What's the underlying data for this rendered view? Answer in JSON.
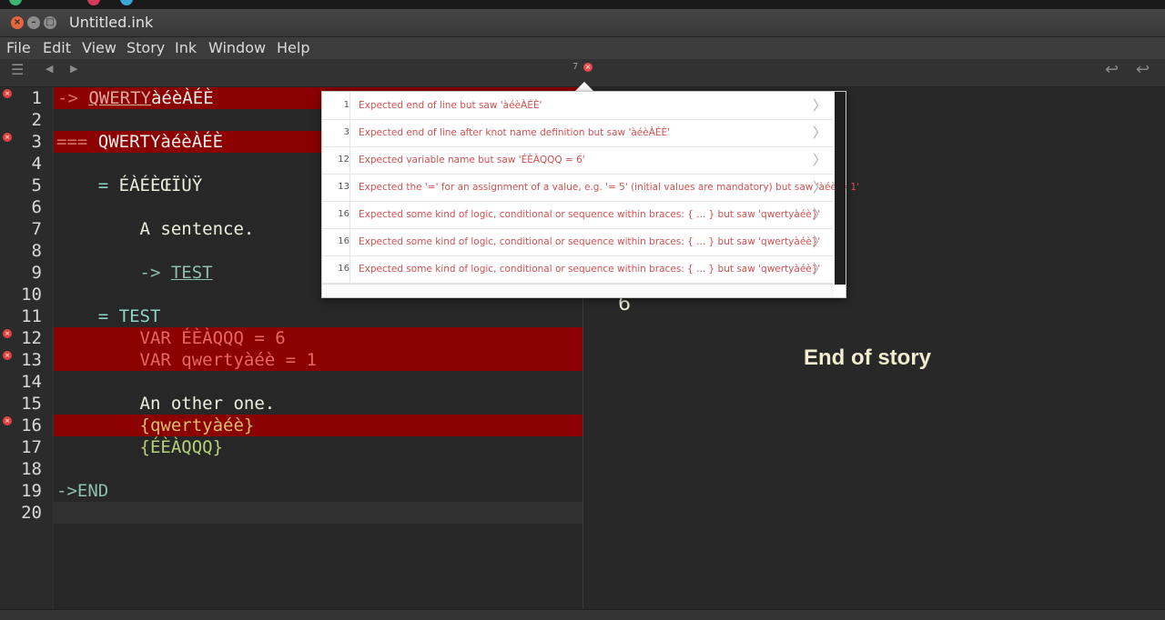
{
  "window": {
    "title": "Untitled.ink"
  },
  "menu": [
    "File",
    "Edit",
    "View",
    "Story",
    "Ink",
    "Window",
    "Help"
  ],
  "toolbar": {
    "issue_count": "7"
  },
  "code_lines": [
    {
      "n": "1",
      "err": true
    },
    {
      "n": "2"
    },
    {
      "n": "3",
      "err": true
    },
    {
      "n": "4"
    },
    {
      "n": "5"
    },
    {
      "n": "6"
    },
    {
      "n": "7"
    },
    {
      "n": "8"
    },
    {
      "n": "9"
    },
    {
      "n": "10"
    },
    {
      "n": "11"
    },
    {
      "n": "12",
      "err": true
    },
    {
      "n": "13",
      "err": true
    },
    {
      "n": "14"
    },
    {
      "n": "15"
    },
    {
      "n": "16",
      "err": true
    },
    {
      "n": "17"
    },
    {
      "n": "18"
    },
    {
      "n": "19"
    },
    {
      "n": "20"
    }
  ],
  "code": {
    "l1_arrow": "-> ",
    "l1_link": "QWERTY",
    "l1_rest": "àéèÀÉÈ",
    "l3_marker": "=== ",
    "l3_name": "QWERTYàéèÀÉÈ",
    "l5_stitch_marker": "    = ",
    "l5_name": "ÉÀÉÈŒÏÙŸ",
    "l7_text": "        A sentence.",
    "l9_arrow": "        -> ",
    "l9_link": "TEST",
    "l11_stitch": "    = TEST",
    "l12_var": "        VAR ÉÈÀQQQ = 6",
    "l13_var": "        VAR qwertyàéè = 1",
    "l15_text": "        An other one.",
    "l16_logic": "        {qwertyàéè}",
    "l17_logic": "        {ÉÈÀQQQ}",
    "l19_end": "->END"
  },
  "issues": [
    {
      "line": "1",
      "message": "Expected end of line but saw 'àéèÀÉÈ'"
    },
    {
      "line": "3",
      "message": "Expected end of line after knot name definition but saw 'àéèÀÉÈ'"
    },
    {
      "line": "12",
      "message": "Expected variable name but saw 'ÉÈÀQQQ = 6'"
    },
    {
      "line": "13",
      "message": "Expected the '=' for an assignment of a value, e.g. '= 5' (initial values are mandatory) but saw 'àéè = 1'"
    },
    {
      "line": "16",
      "message": "Expected some kind of logic, conditional or sequence within braces: { ... } but saw 'qwertyàéè}'"
    },
    {
      "line": "16",
      "message": "Expected some kind of logic, conditional or sequence within braces: { ... } but saw 'qwertyàéè}'"
    },
    {
      "line": "16",
      "message": "Expected some kind of logic, conditional or sequence within braces: { ... } but saw 'qwertyàéè}'"
    }
  ],
  "player": {
    "output_value": "6",
    "end_text": "End of story"
  }
}
